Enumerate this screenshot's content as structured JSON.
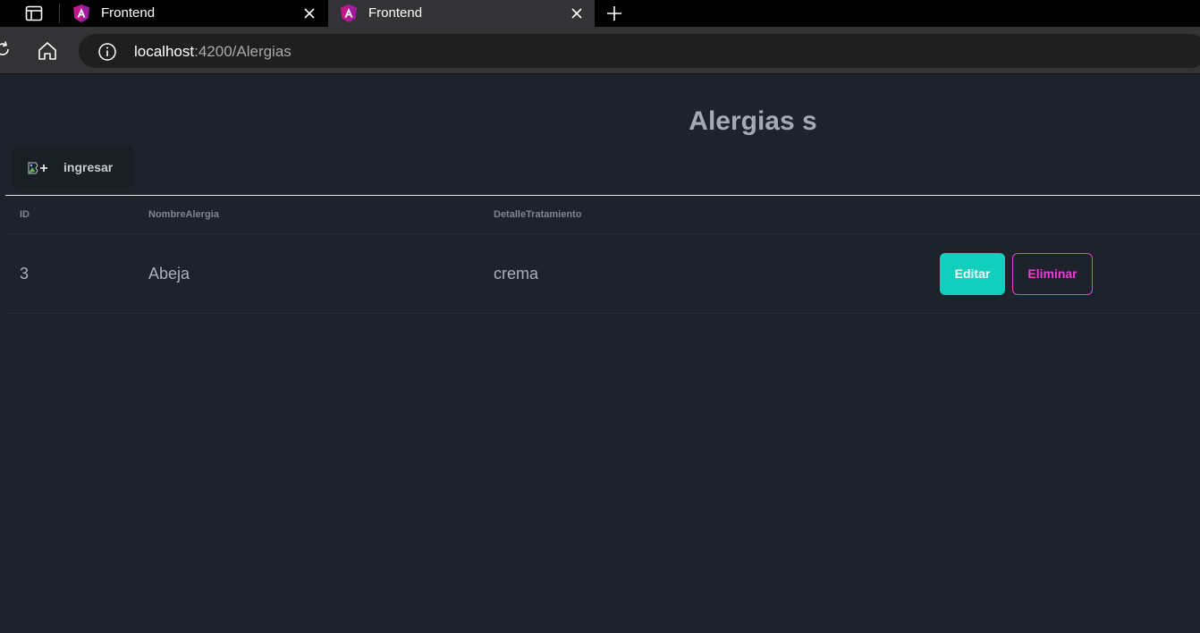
{
  "browser": {
    "tabs": [
      {
        "title": "Frontend",
        "active": false,
        "favicon": "angular-icon"
      },
      {
        "title": "Frontend",
        "active": true,
        "favicon": "angular-icon"
      }
    ],
    "url_host": "localhost",
    "url_rest": ":4200/Alergias"
  },
  "page": {
    "title": "Alergias s",
    "ingresar_label": "ingresar",
    "table": {
      "headers": [
        "ID",
        "NombreAlergia",
        "DetalleTratamiento",
        ""
      ],
      "rows": [
        {
          "id": "3",
          "nombre": "Abeja",
          "detalle": "crema",
          "edit_label": "Editar",
          "delete_label": "Eliminar"
        }
      ]
    }
  },
  "colors": {
    "accent_edit": "#12cfbd",
    "accent_delete": "#e73fd6",
    "page_bg": "#1e232b"
  }
}
